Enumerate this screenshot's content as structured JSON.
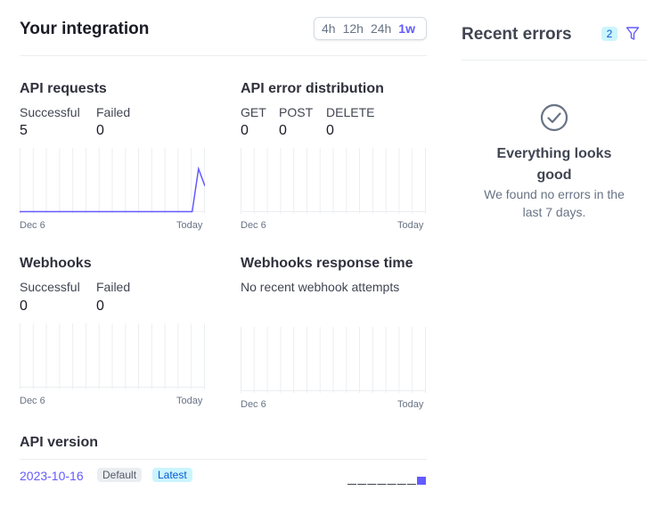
{
  "integration": {
    "title": "Your integration",
    "time_ranges": [
      "4h",
      "12h",
      "24h",
      "1w"
    ],
    "active_range": "1w"
  },
  "api_requests": {
    "title": "API requests",
    "metrics": [
      {
        "label": "Successful",
        "value": "5"
      },
      {
        "label": "Failed",
        "value": "0"
      }
    ],
    "axis_start": "Dec 6",
    "axis_end": "Today"
  },
  "api_error_distribution": {
    "title": "API error distribution",
    "metrics": [
      {
        "label": "GET",
        "value": "0"
      },
      {
        "label": "POST",
        "value": "0"
      },
      {
        "label": "DELETE",
        "value": "0"
      }
    ],
    "axis_start": "Dec 6",
    "axis_end": "Today"
  },
  "webhooks": {
    "title": "Webhooks",
    "metrics": [
      {
        "label": "Successful",
        "value": "0"
      },
      {
        "label": "Failed",
        "value": "0"
      }
    ],
    "axis_start": "Dec 6",
    "axis_end": "Today"
  },
  "webhooks_response_time": {
    "title": "Webhooks response time",
    "subtitle": "No recent webhook attempts",
    "axis_start": "Dec 6",
    "axis_end": "Today"
  },
  "api_version": {
    "title": "API version",
    "version": "2023-10-16",
    "tags": [
      "Default",
      "Latest"
    ]
  },
  "recent_errors": {
    "title": "Recent errors",
    "count": "2",
    "empty_title": "Everything looks good",
    "empty_body": "We found no errors in the last 7 days."
  },
  "colors": {
    "accent": "#635bff",
    "grid": "#ebeef1",
    "check_icon": "#687385"
  },
  "chart_data": [
    {
      "type": "line",
      "title": "API requests",
      "x_start": "Dec 6",
      "x_end": "Today",
      "series": [
        {
          "values": [
            0,
            0,
            0,
            0,
            0,
            0,
            0,
            0,
            0,
            0,
            0,
            0,
            0,
            0,
            0,
            0,
            0,
            0,
            0,
            0,
            0,
            0,
            0,
            0,
            0,
            0,
            0,
            0,
            5,
            3
          ]
        }
      ],
      "ylim": [
        0,
        5
      ]
    },
    {
      "type": "line",
      "title": "API error distribution",
      "x_start": "Dec 6",
      "x_end": "Today",
      "series": [],
      "ylim": [
        0,
        1
      ]
    },
    {
      "type": "line",
      "title": "Webhooks",
      "x_start": "Dec 6",
      "x_end": "Today",
      "series": [],
      "ylim": [
        0,
        1
      ]
    },
    {
      "type": "line",
      "title": "Webhooks response time",
      "x_start": "Dec 6",
      "x_end": "Today",
      "series": [],
      "ylim": [
        0,
        1
      ]
    },
    {
      "type": "bar",
      "title": "API version",
      "series": [
        {
          "values": [
            0,
            0,
            0,
            0,
            0,
            0,
            0,
            1
          ]
        }
      ],
      "ylim": [
        0,
        1
      ]
    }
  ]
}
